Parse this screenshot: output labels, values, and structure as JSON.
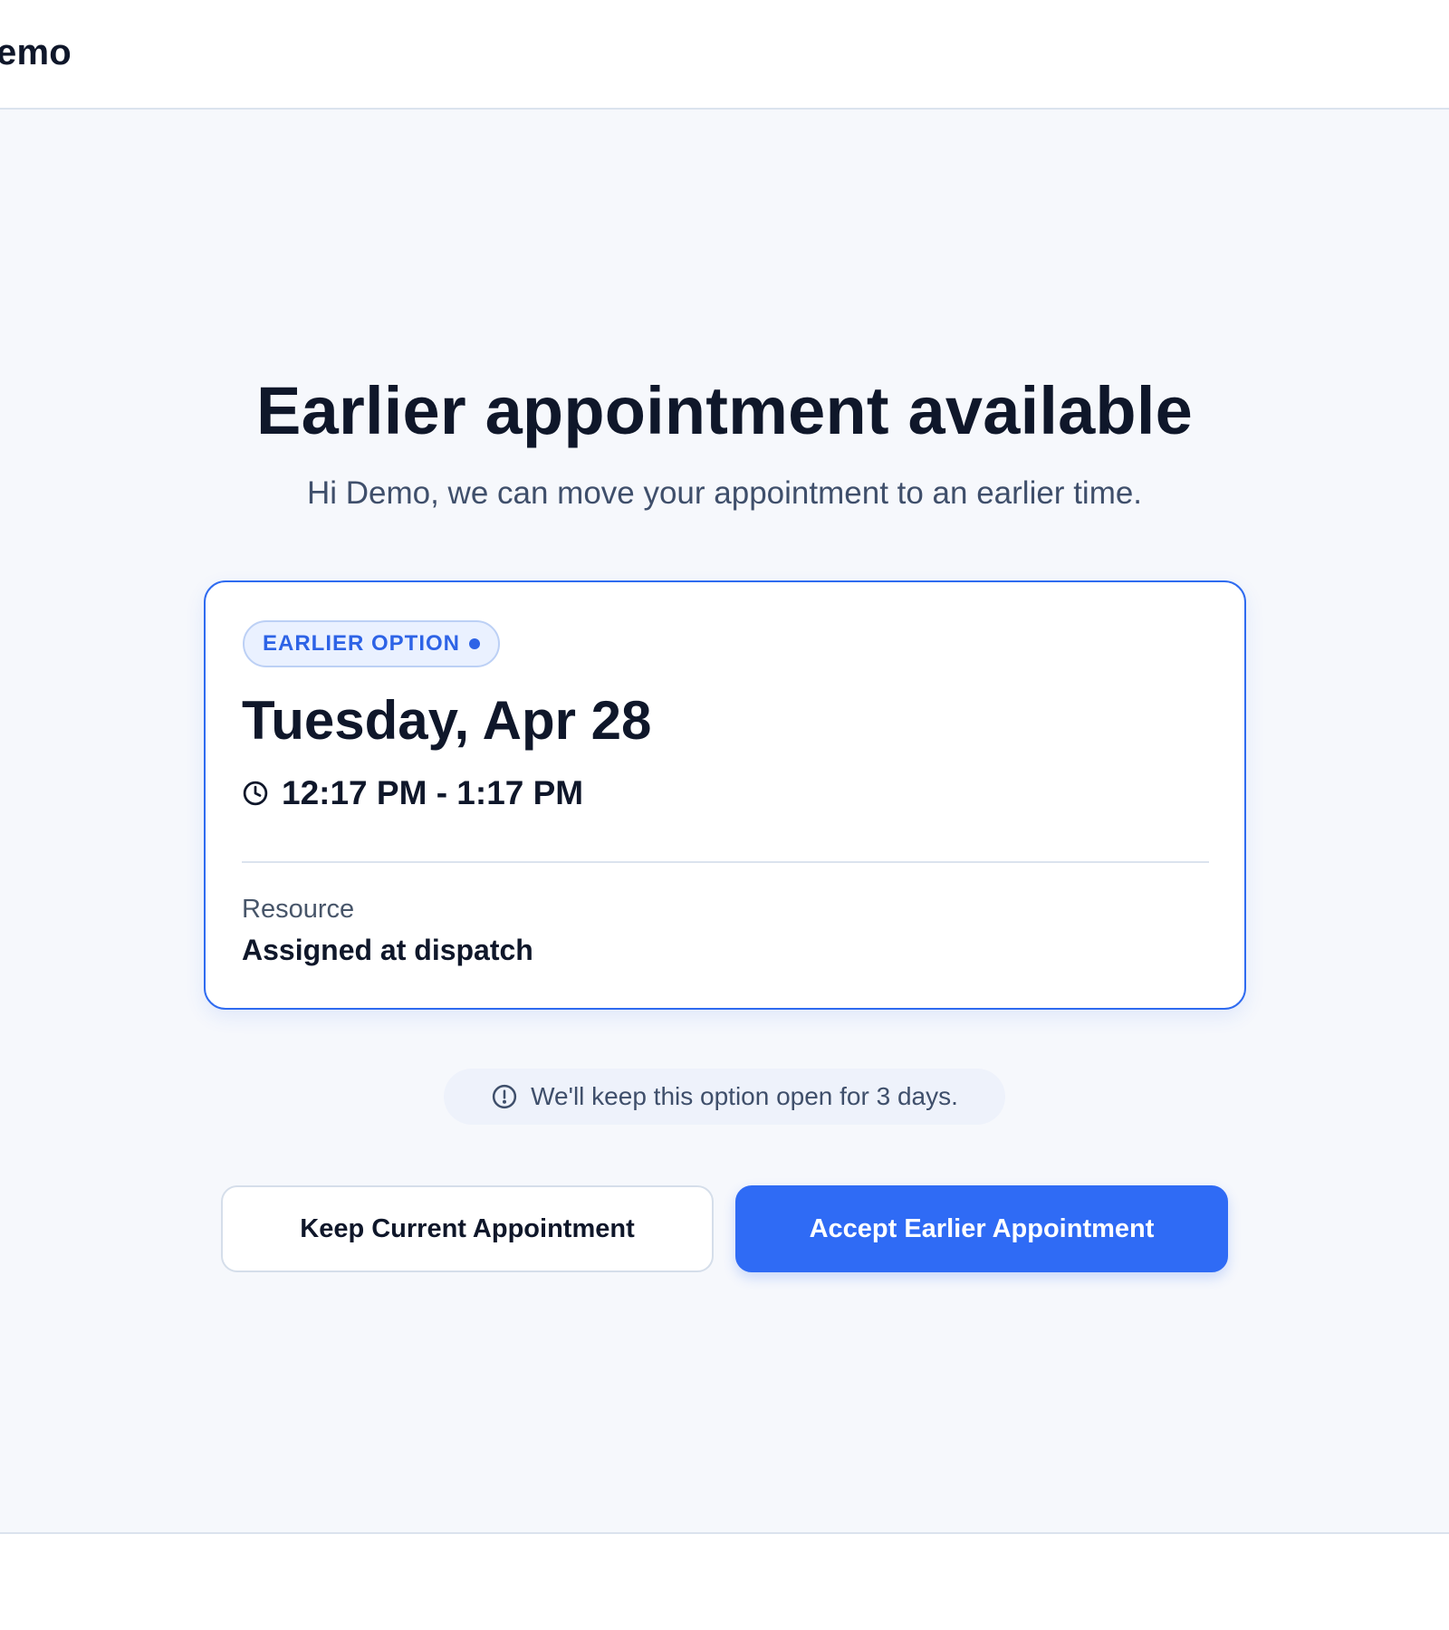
{
  "header": {
    "brand_text": "emo"
  },
  "main": {
    "title": "Earlier appointment available",
    "subtitle": "Hi Demo, we can move your appointment to an earlier time."
  },
  "card": {
    "badge_label": "EARLIER OPTION",
    "date": "Tuesday, Apr 28",
    "time_range": "12:17 PM - 1:17 PM",
    "resource_label": "Resource",
    "resource_value": "Assigned at dispatch"
  },
  "notice": {
    "text": "We'll keep this option open for 3 days."
  },
  "actions": {
    "keep_label": "Keep Current Appointment",
    "accept_label": "Accept Earlier Appointment"
  },
  "icons": {
    "clock": "clock-icon",
    "info": "info-circle-icon"
  },
  "colors": {
    "accent": "#2f6bf5",
    "page_background": "#f6f8fc",
    "badge_background": "#eaf1ff"
  }
}
